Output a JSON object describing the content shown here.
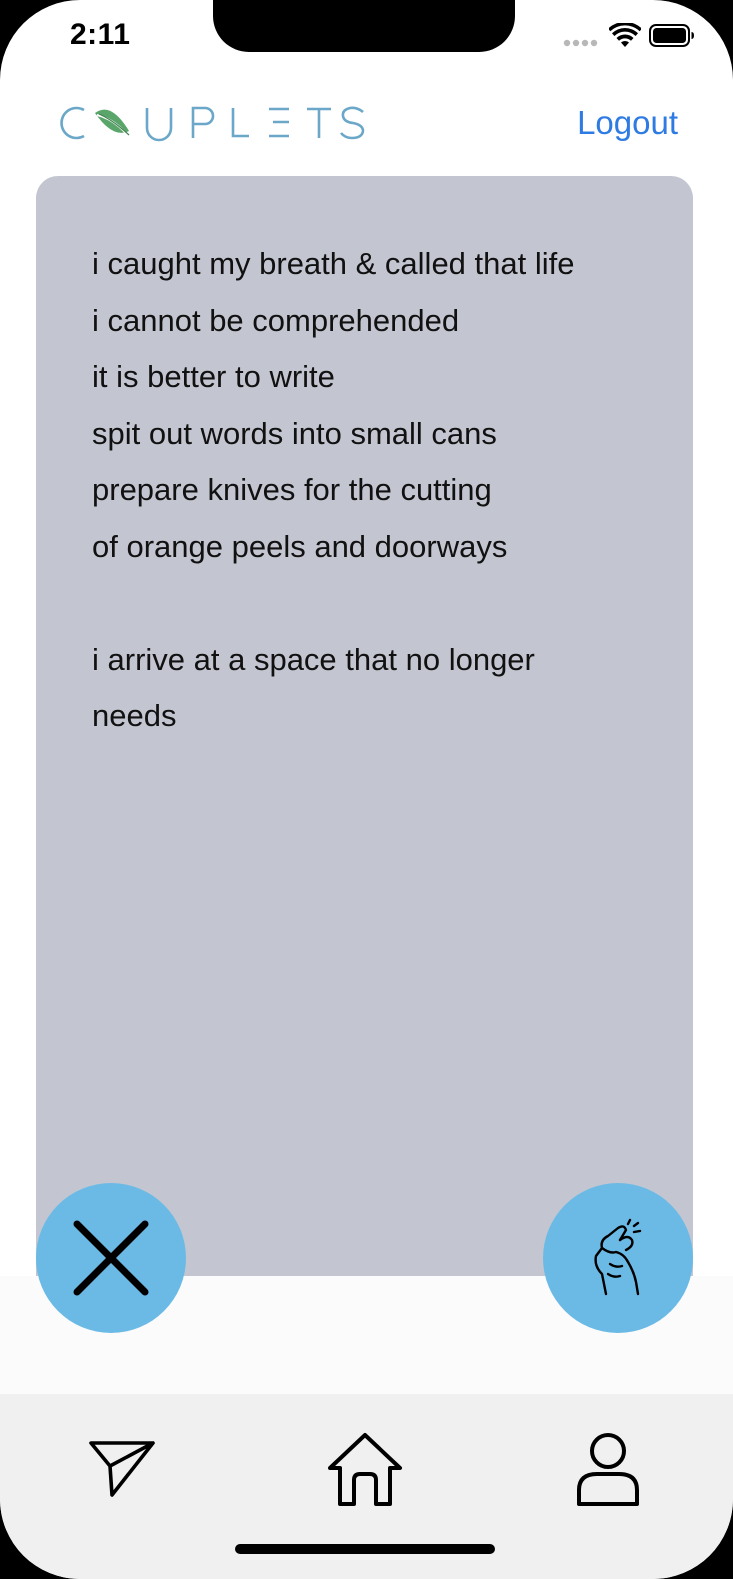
{
  "status_bar": {
    "time": "2:11",
    "icons": [
      "signal-dots-icon",
      "wifi-icon",
      "battery-icon"
    ]
  },
  "header": {
    "logo_text": "COUPLETS",
    "logo_icon": "leaf-icon",
    "logout_label": "Logout"
  },
  "poem": {
    "text": "i caught my breath & called that life\ni cannot be comprehended\nit is better to write\nspit out words into small cans\nprepare knives for the cutting\nof orange peels and doorways\n\ni arrive at a space that no longer\nneeds"
  },
  "actions": {
    "dismiss_icon": "close-x-icon",
    "snap_icon": "finger-snap-icon"
  },
  "tab_bar": {
    "items": [
      "send-icon",
      "home-icon",
      "profile-icon"
    ]
  },
  "colors": {
    "card_background": "#c3c6d1",
    "fab_background": "#6bbae6",
    "logo_color": "#6aa7c8",
    "leaf_color": "#5aa66a",
    "link_color": "#2e7be3",
    "tabbar_background": "#f0f0f0"
  }
}
